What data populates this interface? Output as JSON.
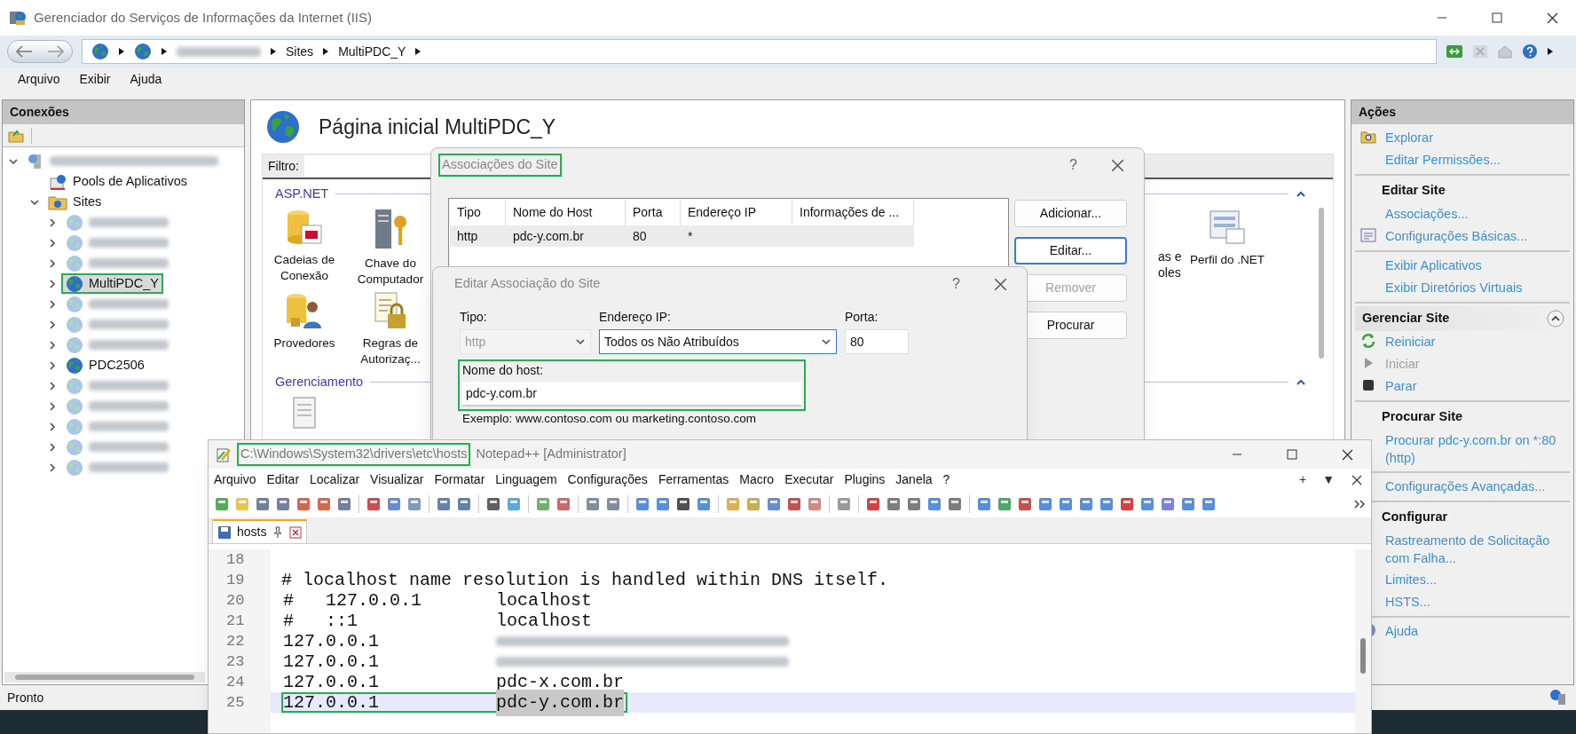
{
  "iis": {
    "title": "Gerenciador do Serviços de Informações da Internet (IIS)",
    "breadcrumb": [
      {
        "kind": "globe"
      },
      {
        "kind": "globe"
      },
      {
        "kind": "redacted"
      },
      {
        "kind": "text",
        "label": "Sites"
      },
      {
        "kind": "text",
        "label": "MultiPDC_Y"
      }
    ],
    "menu": [
      "Arquivo",
      "Exibir",
      "Ajuda"
    ],
    "connections": {
      "title": "Conexões",
      "tree": [
        {
          "kind": "server",
          "redacted": true,
          "expanded": true,
          "selected": false,
          "children": [
            {
              "kind": "pools",
              "label": "Pools de Aplicativos",
              "selected": false
            },
            {
              "kind": "sites",
              "label": "Sites",
              "expanded": true,
              "selected": false,
              "children": [
                {
                  "kind": "site",
                  "redacted": true,
                  "expanded": false,
                  "selected": false,
                  "highlighted": false
                },
                {
                  "kind": "site",
                  "redacted": true,
                  "expanded": false,
                  "selected": false,
                  "highlighted": false
                },
                {
                  "kind": "site",
                  "redacted": true,
                  "expanded": false,
                  "selected": false,
                  "highlighted": false
                },
                {
                  "kind": "site",
                  "label": "MultiPDC_Y",
                  "redacted": false,
                  "expanded": false,
                  "selected": true,
                  "highlighted": true
                },
                {
                  "kind": "site",
                  "redacted": true,
                  "expanded": false,
                  "selected": false,
                  "highlighted": false
                },
                {
                  "kind": "site",
                  "redacted": true,
                  "expanded": false,
                  "selected": false,
                  "highlighted": false
                },
                {
                  "kind": "site",
                  "redacted": true,
                  "expanded": false,
                  "selected": false,
                  "highlighted": false
                },
                {
                  "kind": "site",
                  "label": "PDC2506",
                  "redacted": false,
                  "expanded": false,
                  "selected": false,
                  "highlighted": false
                },
                {
                  "kind": "site",
                  "redacted": true,
                  "expanded": false,
                  "selected": false,
                  "highlighted": false
                },
                {
                  "kind": "site",
                  "redacted": true,
                  "expanded": false,
                  "selected": false,
                  "highlighted": false
                },
                {
                  "kind": "site",
                  "redacted": true,
                  "expanded": false,
                  "selected": false,
                  "highlighted": false
                },
                {
                  "kind": "site",
                  "redacted": true,
                  "expanded": false,
                  "selected": false,
                  "highlighted": false
                },
                {
                  "kind": "site",
                  "redacted": true,
                  "expanded": false,
                  "selected": false,
                  "highlighted": false
                }
              ]
            }
          ]
        }
      ]
    },
    "home": {
      "title": "Página inicial MultiPDC_Y",
      "filter_label": "Filtro:",
      "groups": [
        {
          "title": "ASP.NET",
          "rows": [
            [
              {
                "kind": "connection-strings",
                "label": "Cadeias de Conexão",
                "cut": false
              },
              {
                "kind": "machine-key",
                "label": "Chave do Computador",
                "cut": false
              },
              {
                "label": "as e oles",
                "cut": true
              },
              {
                "kind": "profile",
                "label": "Perfil do .NET",
                "cut": false
              }
            ],
            [
              {
                "kind": "providers",
                "label": "Provedores",
                "cut": false
              },
              {
                "kind": "authorization",
                "label": "Regras de Autorizaç...",
                "cut": false
              }
            ]
          ]
        },
        {
          "title": "Gerenciamento",
          "rows": [
            [
              {
                "kind": "document",
                "cut": false
              }
            ]
          ]
        }
      ]
    },
    "actions": {
      "title": "Ações",
      "sections": [
        {
          "items": [
            {
              "label": "Explorar",
              "kind": "explore",
              "disabled": false
            },
            {
              "label": "Editar Permissões...",
              "disabled": false
            }
          ]
        },
        {
          "heading": "Editar Site",
          "items": [
            {
              "label": "Associações...",
              "disabled": false
            },
            {
              "label": "Configurações Básicas...",
              "kind": "settings-page",
              "disabled": false
            }
          ]
        },
        {
          "items": [
            {
              "label": "Exibir Aplicativos",
              "disabled": false
            },
            {
              "label": "Exibir Diretórios Virtuais",
              "disabled": false
            }
          ]
        },
        {
          "heading": "Gerenciar Site",
          "collapsible": true,
          "items": [
            {
              "label": "Reiniciar",
              "kind": "restart",
              "disabled": false
            },
            {
              "label": "Iniciar",
              "kind": "start",
              "disabled": true
            },
            {
              "label": "Parar",
              "kind": "stop",
              "disabled": false
            }
          ]
        },
        {
          "heading": "Procurar Site",
          "items": [
            {
              "label": "Procurar pdc-y.com.br on *:80 (http)",
              "disabled": false
            }
          ]
        },
        {
          "items": [
            {
              "label": "Configurações Avançadas...",
              "disabled": false
            }
          ]
        },
        {
          "heading": "Configurar",
          "items": [
            {
              "label": "Rastreamento de Solicitação com Falha...",
              "disabled": false
            },
            {
              "label": "Limites...",
              "disabled": false
            },
            {
              "label": "HSTS...",
              "disabled": false
            }
          ]
        },
        {
          "items": [
            {
              "label": "Ajuda",
              "kind": "help",
              "disabled": false
            }
          ]
        }
      ]
    },
    "status_bar": "Pronto"
  },
  "bindings_dialog": {
    "title": "Associações do Site",
    "highlighted": true,
    "help": "?",
    "columns": [
      "Tipo",
      "Nome do Host",
      "Porta",
      "Endereço IP",
      "Informações de ..."
    ],
    "rows": [
      {
        "cells": [
          "http",
          "pdc-y.com.br",
          "80",
          "*"
        ],
        "selected": true
      }
    ],
    "buttons": [
      {
        "label": "Adicionar...",
        "disabled": false,
        "focused": false
      },
      {
        "label": "Editar...",
        "disabled": false,
        "focused": true
      },
      {
        "label": "Remover",
        "disabled": true,
        "focused": false
      },
      {
        "label": "Procurar",
        "disabled": false,
        "focused": false
      }
    ]
  },
  "edit_dialog": {
    "title": "Editar Associação do Site",
    "help": "?",
    "fields": [
      {
        "kind": "select",
        "label": "Tipo:",
        "value": "http",
        "disabled": true
      },
      {
        "kind": "select",
        "label": "Endereço IP:",
        "value": "Todos os Não Atribuídos",
        "disabled": false
      },
      {
        "kind": "text",
        "label": "Porta:",
        "value": "80",
        "disabled": false
      }
    ],
    "host_field": {
      "label": "Nome do host:",
      "value": "pdc-y.com.br",
      "highlighted": true
    },
    "example": "Exemplo: www.contoso.com ou marketing.contoso.com"
  },
  "notepad": {
    "path": "C:\\Windows\\System32\\drivers\\etc\\hosts",
    "path_highlighted": true,
    "app": "Notepad++ [Administrator]",
    "menu": [
      "Arquivo",
      "Editar",
      "Localizar",
      "Visualizar",
      "Formatar",
      "Linguagem",
      "Configurações",
      "Ferramentas",
      "Macro",
      "Executar",
      "Plugins",
      "Janela",
      "?"
    ],
    "menu_right": [
      "+",
      "▼"
    ],
    "tabs": [
      {
        "label": "hosts",
        "selected": true
      }
    ],
    "lines": [
      {
        "number": "18",
        "kind": "blank",
        "current": false
      },
      {
        "number": "19",
        "kind": "comment",
        "text": "# localhost name resolution is handled within DNS itself.",
        "current": false
      },
      {
        "number": "20",
        "kind": "entry",
        "comment": "#",
        "ip": "127.0.0.1",
        "host": "localhost",
        "current": false,
        "highlighted": false
      },
      {
        "number": "21",
        "kind": "entry",
        "comment": "#",
        "ip": "::1",
        "host": "localhost",
        "current": false,
        "highlighted": false
      },
      {
        "number": "22",
        "kind": "entry",
        "ip": "127.0.0.1",
        "host_redacted": true,
        "current": false,
        "highlighted": false
      },
      {
        "number": "23",
        "kind": "entry",
        "ip": "127.0.0.1",
        "host_redacted": true,
        "current": false,
        "highlighted": false
      },
      {
        "number": "24",
        "kind": "entry",
        "ip": "127.0.0.1",
        "host": "pdc-x.com.br",
        "current": false,
        "highlighted": false
      },
      {
        "number": "25",
        "kind": "entry",
        "ip": "127.0.0.1",
        "host": "pdc-y.com.br",
        "current": true,
        "highlighted": true,
        "host_selected": true
      }
    ]
  }
}
